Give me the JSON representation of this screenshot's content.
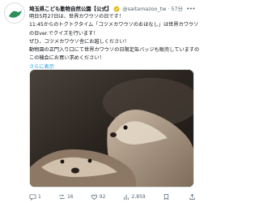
{
  "account": {
    "name": "埼玉県こども動物自然公園【公式】",
    "handle": "@saitamazoo_tw",
    "separator": "·",
    "time": "57分"
  },
  "post": {
    "lines": [
      "明日5月27日は、世界カワウソの日です！",
      "11:45からのトクトクタイム「コツメカワウソのおはなし」は世界カワウソ",
      "の日ver.でクイズを行います！",
      "ぜひ、コツメカワウソ舎にお越しください！",
      "動物園の正門入り口にて世界カワウソの日限定缶バッジも販売していますので、",
      "この機会にお買い求めください！"
    ],
    "show_more": "さらに表示"
  },
  "actions": {
    "reply_count": "1",
    "repost_count": "16",
    "like_count": "92",
    "view_count": "2,859"
  },
  "colors": {
    "link": "#1d9bf0",
    "verified": "#e2b719",
    "muted": "#536471"
  },
  "icons": [
    "verified-badge-icon",
    "more-icon",
    "reply-icon",
    "repost-icon",
    "like-icon",
    "views-icon",
    "bookmark-icon",
    "share-icon"
  ]
}
